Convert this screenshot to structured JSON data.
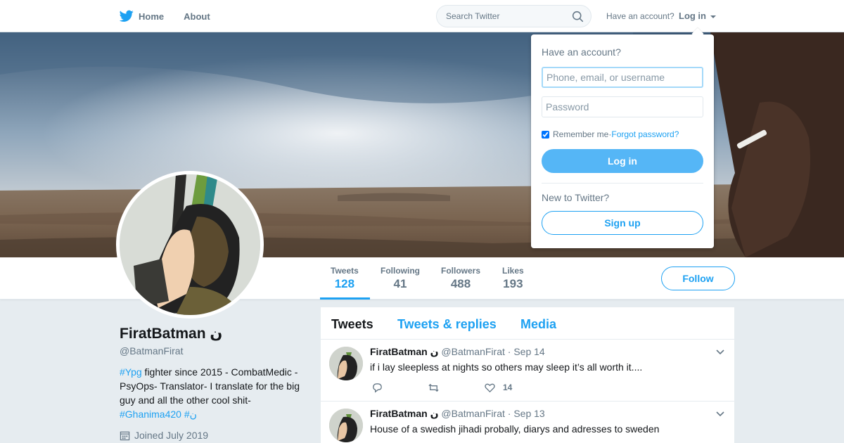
{
  "nav": {
    "home_label": "Home",
    "about_label": "About",
    "search_placeholder": "Search Twitter",
    "have_account": "Have an account?",
    "login_label": "Log in"
  },
  "profile_nav": {
    "stats": [
      {
        "label": "Tweets",
        "value": "128"
      },
      {
        "label": "Following",
        "value": "41"
      },
      {
        "label": "Followers",
        "value": "488"
      },
      {
        "label": "Likes",
        "value": "193"
      }
    ],
    "follow_label": "Follow"
  },
  "profile": {
    "name": "FiratBatman ن",
    "handle": "@BatmanFirat",
    "bio_tag1": "#Ypg",
    "bio_text": " fighter since 2015 - CombatMedic - PsyOps- Translator- I translate for the big guy and all the other cool shit-",
    "bio_tag2": "#Ghanima420",
    "bio_tag3": "#ن",
    "joined": "Joined July 2019"
  },
  "timeline": {
    "tabs": [
      "Tweets",
      "Tweets & replies",
      "Media"
    ],
    "tweets": [
      {
        "name": "FiratBatman ن",
        "handle": "@BatmanFirat",
        "sep": "·",
        "date": "Sep 14",
        "text": "if i lay sleepless at nights so others may sleep it’s all worth it....",
        "likes": "14"
      },
      {
        "name": "FiratBatman ن",
        "handle": "@BatmanFirat",
        "sep": "·",
        "date": "Sep 13",
        "text": "House of a swedish jihadi probally, diarys and adresses to sweden"
      }
    ]
  },
  "login_dropdown": {
    "title": "Have an account?",
    "username_placeholder": "Phone, email, or username",
    "password_placeholder": "Password",
    "remember_label": "Remember me",
    "separator": " · ",
    "forgot_label": "Forgot password?",
    "login_button": "Log in",
    "new_label": "New to Twitter?",
    "signup_button": "Sign up"
  },
  "colors": {
    "accent": "#1da1f2",
    "background": "#e6ecf0",
    "text_secondary": "#657786"
  }
}
